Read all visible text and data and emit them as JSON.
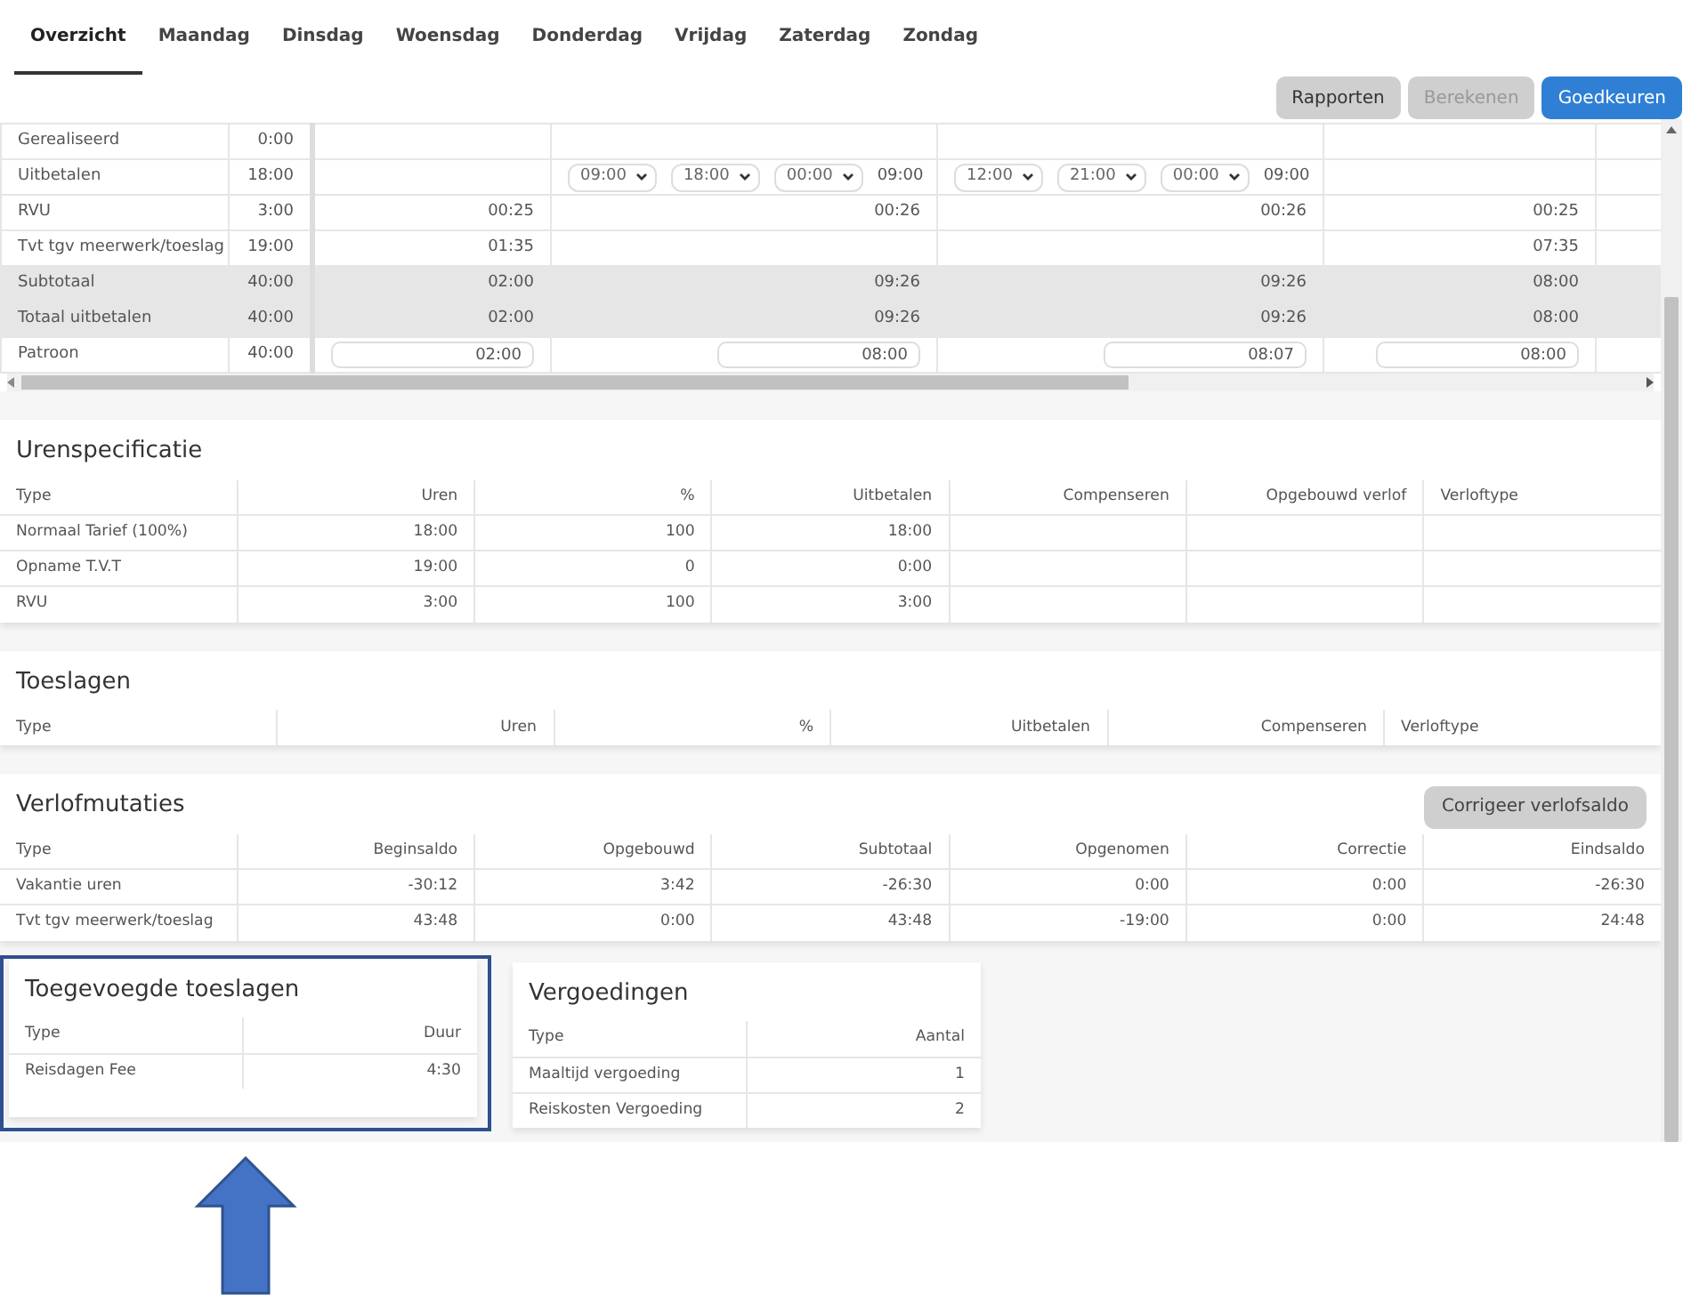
{
  "tabs": [
    {
      "label": "Overzicht",
      "selected": true
    },
    {
      "label": "Maandag",
      "selected": false
    },
    {
      "label": "Dinsdag",
      "selected": false
    },
    {
      "label": "Woensdag",
      "selected": false
    },
    {
      "label": "Donderdag",
      "selected": false
    },
    {
      "label": "Vrijdag",
      "selected": false
    },
    {
      "label": "Zaterdag",
      "selected": false
    },
    {
      "label": "Zondag",
      "selected": false
    }
  ],
  "toolbar_buttons": [
    {
      "label": "Rapporten",
      "kind": "secondary",
      "disabled": false
    },
    {
      "label": "Berekenen",
      "kind": "secondary",
      "disabled": true
    },
    {
      "label": "Goedkeuren",
      "kind": "primary",
      "disabled": false
    }
  ],
  "week_grid": {
    "rows": [
      {
        "label": "Gerealiseerd",
        "total": "0:00",
        "highlighted": false,
        "cells": [
          {
            "kind": "empty"
          },
          {
            "kind": "empty"
          },
          {
            "kind": "empty"
          },
          {
            "kind": "empty"
          },
          {
            "kind": "empty"
          }
        ]
      },
      {
        "label": "Uitbetalen",
        "total": "18:00",
        "highlighted": false,
        "cells": [
          {
            "kind": "empty"
          },
          {
            "kind": "times",
            "selects": [
              "09:00",
              "18:00",
              "00:00"
            ],
            "value": "09:00"
          },
          {
            "kind": "times",
            "selects": [
              "12:00",
              "21:00",
              "00:00"
            ],
            "value": "09:00"
          },
          {
            "kind": "empty"
          },
          {
            "kind": "empty"
          }
        ]
      },
      {
        "label": "RVU",
        "total": "3:00",
        "highlighted": false,
        "cells": [
          {
            "kind": "text",
            "value": "00:25"
          },
          {
            "kind": "text",
            "value": "00:26"
          },
          {
            "kind": "text",
            "value": "00:26"
          },
          {
            "kind": "text",
            "value": "00:25"
          },
          {
            "kind": "empty"
          }
        ]
      },
      {
        "label": "Tvt tgv meerwerk/toeslag",
        "total": "19:00",
        "highlighted": false,
        "cells": [
          {
            "kind": "text",
            "value": "01:35"
          },
          {
            "kind": "empty"
          },
          {
            "kind": "empty"
          },
          {
            "kind": "text",
            "value": "07:35"
          },
          {
            "kind": "empty"
          }
        ]
      },
      {
        "label": "Subtotaal",
        "total": "40:00",
        "highlighted": true,
        "cells": [
          {
            "kind": "text",
            "value": "02:00"
          },
          {
            "kind": "text",
            "value": "09:26"
          },
          {
            "kind": "text",
            "value": "09:26"
          },
          {
            "kind": "text",
            "value": "08:00"
          },
          {
            "kind": "empty"
          }
        ]
      },
      {
        "label": "Totaal uitbetalen",
        "total": "40:00",
        "highlighted": true,
        "cells": [
          {
            "kind": "text",
            "value": "02:00"
          },
          {
            "kind": "text",
            "value": "09:26"
          },
          {
            "kind": "text",
            "value": "09:26"
          },
          {
            "kind": "text",
            "value": "08:00"
          },
          {
            "kind": "empty"
          }
        ]
      },
      {
        "label": "Patroon",
        "total": "40:00",
        "highlighted": false,
        "cells": [
          {
            "kind": "input",
            "value": "02:00"
          },
          {
            "kind": "input",
            "value": "08:00"
          },
          {
            "kind": "input",
            "value": "08:07"
          },
          {
            "kind": "input",
            "value": "08:00"
          },
          {
            "kind": "empty"
          }
        ]
      }
    ]
  },
  "sections": [
    {
      "title": "Urenspecificatie",
      "columns": [
        {
          "label": "Type",
          "kind": "text"
        },
        {
          "label": "Uren",
          "kind": "number"
        },
        {
          "label": "%",
          "kind": "number"
        },
        {
          "label": "Uitbetalen",
          "kind": "number"
        },
        {
          "label": "Compenseren",
          "kind": "number"
        },
        {
          "label": "Opgebouwd verlof",
          "kind": "number"
        },
        {
          "label": "Verloftype",
          "kind": "text"
        }
      ],
      "rows": [
        [
          "Normaal Tarief (100%)",
          "18:00",
          "100",
          "18:00"
        ],
        [
          "Opname T.V.T",
          "19:00",
          "0",
          "0:00"
        ],
        [
          "RVU",
          "3:00",
          "100",
          "3:00"
        ]
      ]
    },
    {
      "title": "Toeslagen",
      "columns": [
        {
          "label": "Type",
          "kind": "text"
        },
        {
          "label": "Uren",
          "kind": "number"
        },
        {
          "label": "%",
          "kind": "number"
        },
        {
          "label": "Uitbetalen",
          "kind": "number"
        },
        {
          "label": "Compenseren",
          "kind": "number"
        },
        {
          "label": "Verloftype",
          "kind": "text"
        }
      ]
    },
    {
      "title": "Verlofmutaties",
      "button": "Corrigeer verlofsaldo",
      "columns": [
        {
          "label": "Type",
          "kind": "text"
        },
        {
          "label": "Beginsaldo",
          "kind": "number"
        },
        {
          "label": "Opgebouwd",
          "kind": "number"
        },
        {
          "label": "Subtotaal",
          "kind": "number"
        },
        {
          "label": "Opgenomen",
          "kind": "number"
        },
        {
          "label": "Correctie",
          "kind": "number"
        },
        {
          "label": "Eindsaldo",
          "kind": "number"
        }
      ],
      "rows": [
        [
          "Vakantie uren",
          "-30:12",
          "3:42",
          "-26:30",
          "0:00",
          "0:00",
          "-26:30"
        ],
        [
          "Tvt tgv meerwerk/toeslag",
          "43:48",
          "0:00",
          "43:48",
          "-19:00",
          "0:00",
          "24:48"
        ]
      ]
    }
  ],
  "small_sections": [
    {
      "title": "Toegevoegde toeslagen",
      "highlighted": true,
      "columns": [
        {
          "label": "Type",
          "kind": "text"
        },
        {
          "label": "Duur",
          "kind": "number"
        }
      ],
      "rows": [
        [
          "Reisdagen Fee",
          "4:30"
        ]
      ]
    },
    {
      "title": "Vergoedingen",
      "highlighted": false,
      "columns": [
        {
          "label": "Type",
          "kind": "text"
        },
        {
          "label": "Aantal",
          "kind": "number"
        }
      ],
      "rows": [
        [
          "Maaltijd vergoeding",
          "1"
        ],
        [
          "Reiskosten Vergoeding",
          "2"
        ]
      ]
    }
  ]
}
